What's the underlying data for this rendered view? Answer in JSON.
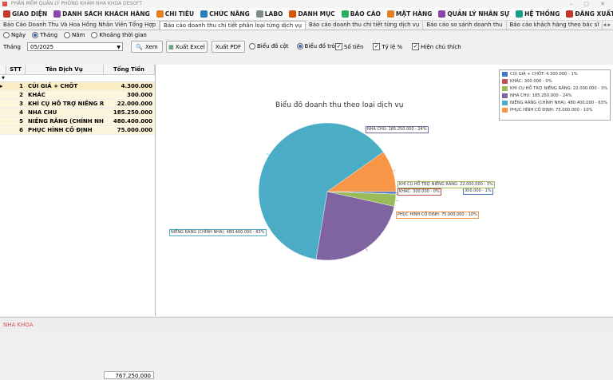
{
  "window": {
    "title": "PHẦN MỀM QUẢN LÝ PHÒNG KHÁM NHA KHOA DESOFT",
    "controls": "–  ▢  ✕"
  },
  "menu": [
    {
      "label": "GIAO DIỆN",
      "icon": "home-icon",
      "color": "#c0392b"
    },
    {
      "label": "DANH SÁCH KHÁCH HÀNG",
      "icon": "user-icon",
      "color": "#8e44ad"
    },
    {
      "label": "CHI TIÊU",
      "icon": "wallet-icon",
      "color": "#e67e22"
    },
    {
      "label": "CHỨC NĂNG",
      "icon": "function-icon",
      "color": "#2980b9"
    },
    {
      "label": "LABO",
      "icon": "flask-icon",
      "color": "#7f8c8d"
    },
    {
      "label": "DANH MỤC",
      "icon": "list-icon",
      "color": "#d35400"
    },
    {
      "label": "BÁO CÁO",
      "icon": "report-icon",
      "color": "#27ae60"
    },
    {
      "label": "MẶT HÀNG",
      "icon": "box-icon",
      "color": "#e67e22"
    },
    {
      "label": "QUẢN LÝ NHÂN SỰ",
      "icon": "staff-icon",
      "color": "#8e44ad"
    },
    {
      "label": "HỆ THỐNG",
      "icon": "gear-icon",
      "color": "#16a085"
    },
    {
      "label": "ĐĂNG XUẤT",
      "icon": "logout-icon",
      "color": "#c0392b"
    }
  ],
  "tabs": [
    {
      "label": "Báo Cáo Doanh Thu Và Hoa Hồng Nhân Viên Tổng Hợp",
      "active": false
    },
    {
      "label": "Báo cáo doanh thu chi tiết phân loại từng dịch vụ",
      "active": true
    },
    {
      "label": "Báo cáo doanh thu chi tiết từng dịch vụ",
      "active": false
    },
    {
      "label": "Báo cáo so sánh doanh thu",
      "active": false
    },
    {
      "label": "Báo cáo khách hàng theo bác sĩ",
      "active": false
    }
  ],
  "tab_nav": "◂ ▸",
  "filters": {
    "period_options": [
      "Ngày",
      "Tháng",
      "Năm",
      "Khoảng thời gian"
    ],
    "period_selected": 1,
    "month_label": "Tháng",
    "month_value": "05/2025",
    "view_button": "Xem",
    "excel_button": "Xuất Excel",
    "pdf_button": "Xuất PDF",
    "chart_types": [
      "Biểu đồ cột",
      "Biểu đồ tròn"
    ],
    "chart_type_selected": 1,
    "show_amount": "Số tiền",
    "show_percent": "Tỷ lệ %",
    "show_note": "Hiện chú thích"
  },
  "grid": {
    "headers": [
      "STT",
      "Tên Dịch Vụ",
      "Tổng Tiền"
    ],
    "rows": [
      {
        "stt": "1",
        "name": "CÚI GIẢ + CHỐT",
        "total": "4.300.000"
      },
      {
        "stt": "2",
        "name": "KHÁC",
        "total": "300.000"
      },
      {
        "stt": "3",
        "name": "KHÍ CỤ HỖ TRỢ NIỀNG R...",
        "total": "22.000.000"
      },
      {
        "stt": "4",
        "name": "NHA CHU",
        "total": "185.250.000"
      },
      {
        "stt": "5",
        "name": "NIỀNG RĂNG (CHỈNH NHA)",
        "total": "480.400.000"
      },
      {
        "stt": "6",
        "name": "PHỤC HÌNH CỐ ĐỊNH",
        "total": "75.000.000"
      }
    ],
    "grand_total": "767.250.000"
  },
  "chart_data": {
    "type": "pie",
    "title": "Biểu đồ doanh thu theo loại dịch vụ",
    "legend_position": "top-right",
    "slices": [
      {
        "name": "CÚI GIẢ + CHỐT",
        "value": 4300000,
        "label": "CÚI GIẢ + CHỐT: 4.300.000 - 1%",
        "color": "#4472c4"
      },
      {
        "name": "KHÁC",
        "value": 300000,
        "label": "KHÁC: 300.000 - 0%",
        "color": "#c0504d"
      },
      {
        "name": "KHÍ CỤ HỖ TRỢ NIỀNG RĂNG",
        "value": 22000000,
        "label": "KHÍ CỤ HỖ TRỢ NIỀNG RĂNG: 22.000.000 - 3%",
        "color": "#9bbb59"
      },
      {
        "name": "NHA CHU",
        "value": 185250000,
        "label": "NHA CHU: 185.250.000 - 24%",
        "color": "#8064a2"
      },
      {
        "name": "NIỀNG RĂNG (CHỈNH NHA)",
        "value": 480400000,
        "label": "NIỀNG RĂNG (CHỈNH NHA): 480.400.000 - 63%",
        "color": "#4bacc6"
      },
      {
        "name": "PHỤC HÌNH CỐ ĐỊNH",
        "value": 75000000,
        "label": "PHỤC HÌNH CỐ ĐỊNH: 75.000.000 - 10%",
        "color": "#f79646"
      }
    ],
    "slice_labels": [
      {
        "name": "CÚI GIẢ + CHỐT",
        "text": "300.000 - 1%"
      },
      {
        "name": "KHÁC",
        "text": "KHÁC: 300.000 - 0%"
      },
      {
        "name": "KHÍ CỤ HỖ TRỢ NIỀNG RĂNG",
        "text": "KHÍ CỤ HỖ TRỢ NIỀNG RĂNG: 22.000.000 - 3%"
      },
      {
        "name": "NHA CHU",
        "text": "NHA CHU: 185.250.000 - 24%"
      },
      {
        "name": "NIỀNG RĂNG (CHỈNH NHA)",
        "text": "NIỀNG RĂNG (CHỈNH NHA): 480.400.000 - 63%"
      },
      {
        "name": "PHỤC HÌNH CỐ ĐỊNH",
        "text": "PHỤC HÌNH CỐ ĐỊNH: 75.000.000 - 10%"
      }
    ]
  },
  "status": {
    "text": "NHA KHOA"
  }
}
